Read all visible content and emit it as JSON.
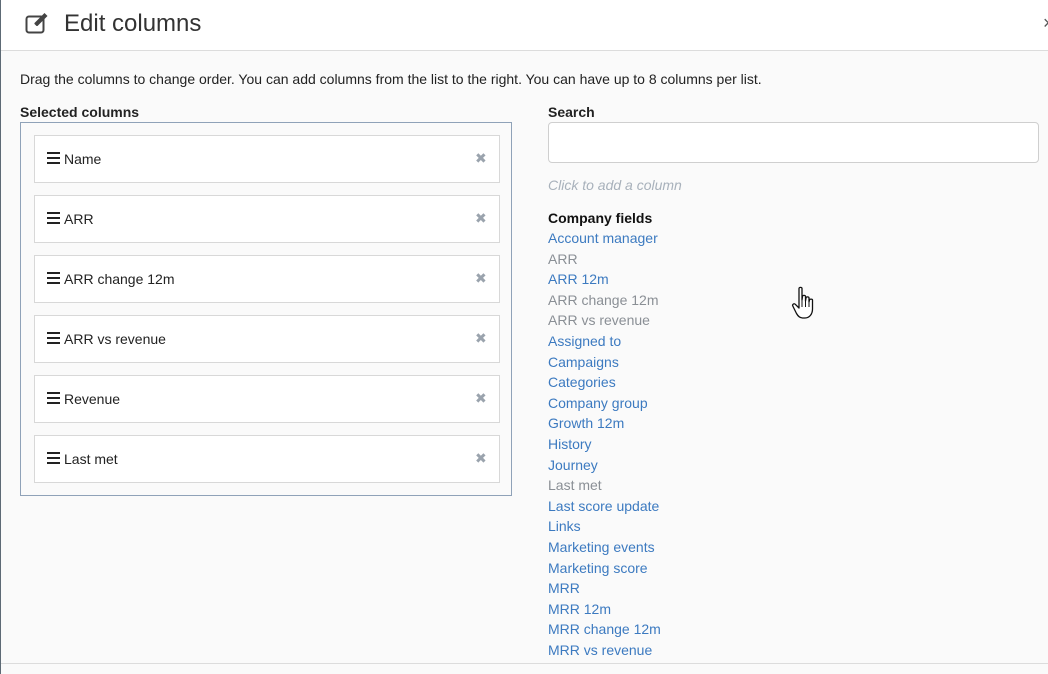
{
  "header": {
    "title": "Edit columns",
    "edit_icon": "edit-icon",
    "close_symbol": "×"
  },
  "description": "Drag the columns to change order. You can add columns from the list to the right. You can have up to 8 columns per list.",
  "selected": {
    "label": "Selected columns",
    "remove_symbol": "✖",
    "items": [
      {
        "label": "Name"
      },
      {
        "label": "ARR"
      },
      {
        "label": "ARR change 12m"
      },
      {
        "label": "ARR vs revenue"
      },
      {
        "label": "Revenue"
      },
      {
        "label": "Last met"
      }
    ]
  },
  "search": {
    "label": "Search",
    "value": "",
    "placeholder": ""
  },
  "hint": "Click to add a column",
  "fields": {
    "heading": "Company fields",
    "items": [
      {
        "label": "Account manager",
        "selected": false
      },
      {
        "label": "ARR",
        "selected": true
      },
      {
        "label": "ARR 12m",
        "selected": false
      },
      {
        "label": "ARR change 12m",
        "selected": true
      },
      {
        "label": "ARR vs revenue",
        "selected": true
      },
      {
        "label": "Assigned to",
        "selected": false
      },
      {
        "label": "Campaigns",
        "selected": false
      },
      {
        "label": "Categories",
        "selected": false
      },
      {
        "label": "Company group",
        "selected": false
      },
      {
        "label": "Growth 12m",
        "selected": false
      },
      {
        "label": "History",
        "selected": false
      },
      {
        "label": "Journey",
        "selected": false
      },
      {
        "label": "Last met",
        "selected": true
      },
      {
        "label": "Last score update",
        "selected": false
      },
      {
        "label": "Links",
        "selected": false
      },
      {
        "label": "Marketing events",
        "selected": false
      },
      {
        "label": "Marketing score",
        "selected": false
      },
      {
        "label": "MRR",
        "selected": false
      },
      {
        "label": "MRR 12m",
        "selected": false
      },
      {
        "label": "MRR change 12m",
        "selected": false
      },
      {
        "label": "MRR vs revenue",
        "selected": false
      }
    ]
  },
  "colors": {
    "link": "#3c7ac0",
    "disabled": "#8a8f95",
    "border_selected_box": "#8fa2b8",
    "hint": "#a8b1bb"
  }
}
